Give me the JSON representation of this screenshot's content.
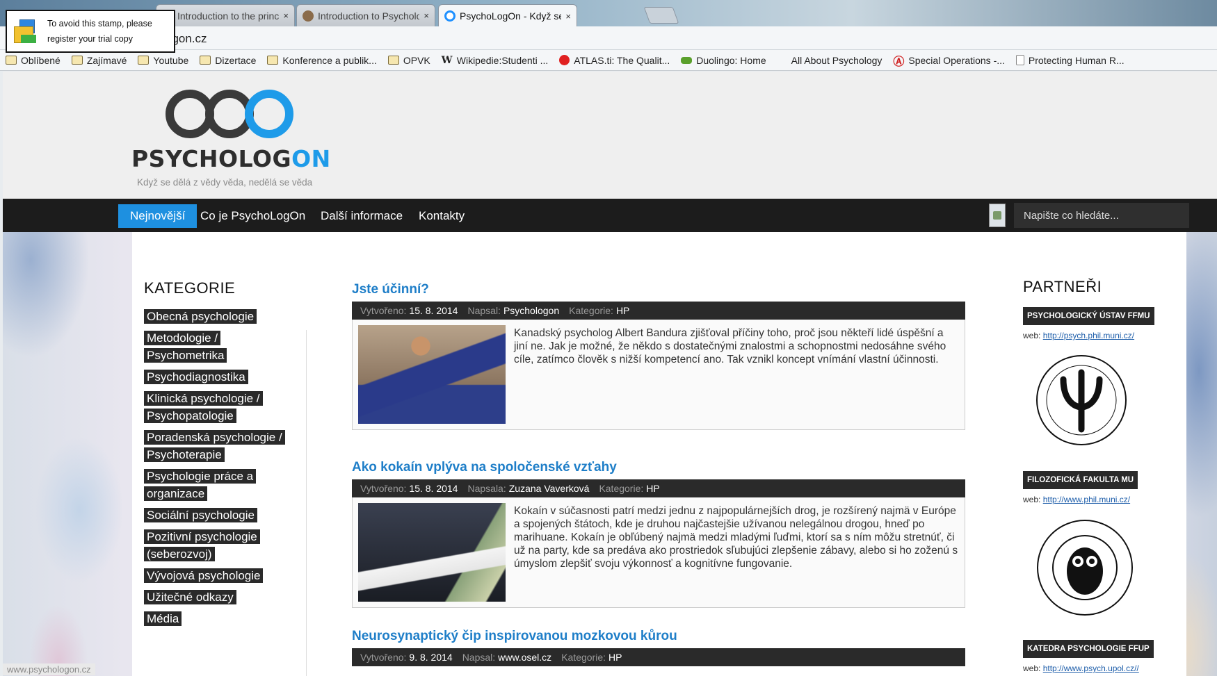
{
  "browser": {
    "tabs": [
      {
        "label": "Introduction to the princi",
        "active": false
      },
      {
        "label": "Introduction to Psycholog",
        "active": false
      },
      {
        "label": "PsychoLogOn - Když se d",
        "active": true
      }
    ],
    "close_glyph": "×",
    "url": "ogon.cz",
    "bookmarks": [
      {
        "label": "Oblíbené",
        "icon": "folder-icon"
      },
      {
        "label": "Zajímavé",
        "icon": "folder-icon"
      },
      {
        "label": "Youtube",
        "icon": "folder-icon"
      },
      {
        "label": "Dizertace",
        "icon": "folder-icon"
      },
      {
        "label": "Konference a publik...",
        "icon": "folder-icon"
      },
      {
        "label": "OPVK",
        "icon": "folder-icon"
      },
      {
        "label": "Wikipedie:Studenti ...",
        "icon": "wikipedia-icon"
      },
      {
        "label": "ATLAS.ti: The Qualit...",
        "icon": "atlas-icon"
      },
      {
        "label": "Duolingo: Home",
        "icon": "duolingo-icon"
      },
      {
        "label": "All About Psychology",
        "icon": "none"
      },
      {
        "label": "Special Operations -...",
        "icon": "avengers-icon"
      },
      {
        "label": "Protecting Human R...",
        "icon": "page-icon"
      }
    ]
  },
  "stamp": {
    "line1": "To avoid this stamp, please",
    "line2": "register your trial copy"
  },
  "site": {
    "logo_text_dark": "PSYCHOLOG",
    "logo_text_blue": "ON",
    "tagline": "Když se dělá z vědy věda, nedělá se věda"
  },
  "nav": {
    "items": [
      "Nejnovější",
      "Co je PsychoLogOn",
      "Další informace",
      "Kontakty"
    ],
    "search_placeholder": "Napište co hledáte..."
  },
  "categories": {
    "title": "KATEGORIE",
    "items": [
      "Obecná psychologie",
      "Metodologie / Psychometrika",
      "Psychodiagnostika",
      "Klinická psychologie / Psychopatologie",
      "Poradenská psychologie / Psychoterapie",
      "Psychologie práce a organizace",
      "Sociální psychologie",
      "Pozitivní psychologie (seberozvoj)",
      "Vývojová psychologie",
      "Užitečné odkazy",
      "Média"
    ]
  },
  "articles": [
    {
      "title": "Jste účinní?",
      "created_label": "Vytvořeno:",
      "created": "15. 8. 2014",
      "author_label": "Napsal:",
      "author": "Psychologon",
      "category_label": "Kategorie:",
      "category": "HP",
      "text": "Kanadský psycholog Albert Bandura zjišťoval příčiny toho, proč jsou někteří lidé úspěšní a jiní ne. Jak je možné, že někdo s dostatečnými znalostmi a schopnostmi nedosáhne svého cíle, zatímco člověk s nižší kompetencí ano. Tak vznikl koncept vnímání vlastní účinnosti."
    },
    {
      "title": "Ako kokaín vplýva na spoločenské vzťahy",
      "created_label": "Vytvořeno:",
      "created": "15. 8. 2014",
      "author_label": "Napsala:",
      "author": "Zuzana Vaverková",
      "category_label": "Kategorie:",
      "category": "HP",
      "text": "Kokaín v súčasnosti patrí medzi jednu z najpopulárnejších drog, je rozšírený najmä v Európe a spojených štátoch, kde je druhou najčastejšie užívanou nelegálnou drogou, hneď po marihuane. Kokaín je obľúbený najmä medzi mladými ľuďmi, ktorí sa s ním môžu stretnúť, či už na party, kde sa predáva ako prostriedok sľubujúci zlepšenie zábavy, alebo si ho zoženú s úmyslom zlepšiť svoju výkonnosť a kognitívne fungovanie."
    },
    {
      "title": "Neurosynaptický čip inspirovanou mozkovou kůrou",
      "created_label": "Vytvořeno:",
      "created": "9. 8. 2014",
      "author_label": "Napsal:",
      "author": "www.osel.cz",
      "category_label": "Kategorie:",
      "category": "HP",
      "text": ""
    }
  ],
  "partners": {
    "title": "PARTNEŘI",
    "web_label": "web:",
    "items": [
      {
        "name": "PSYCHOLOGICKÝ ÚSTAV FFMU",
        "url": "http://psych.phil.muni.cz/"
      },
      {
        "name": "FILOZOFICKÁ FAKULTA MU",
        "url": "http://www.phil.muni.cz/"
      },
      {
        "name": "KATEDRA PSYCHOLOGIE FFUP",
        "url": "http://www.psych.upol.cz//"
      }
    ]
  },
  "status_text": "www.psychologon.cz"
}
